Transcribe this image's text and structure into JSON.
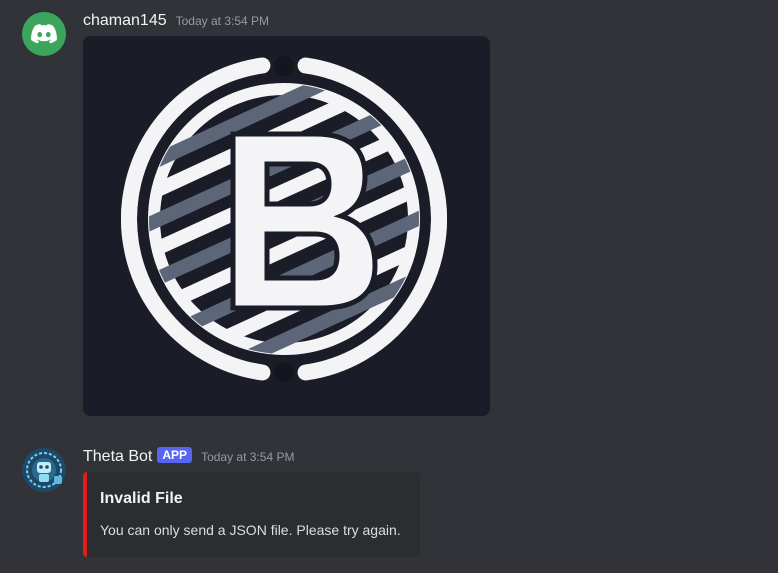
{
  "messages": [
    {
      "username": "chaman145",
      "timestamp": "Today at 3:54 PM",
      "avatar_icon": "discord-logo-icon",
      "avatar_color": "#3ba55d",
      "attachment": {
        "type": "image",
        "letter": "B",
        "background": "#1a1c28"
      }
    },
    {
      "username": "Theta Bot",
      "badge": "APP",
      "timestamp": "Today at 3:54 PM",
      "avatar_icon": "robot-icon",
      "embed": {
        "title": "Invalid File",
        "description": "You can only send a JSON file. Please try again.",
        "accent_color": "#e01e1e"
      }
    }
  ]
}
